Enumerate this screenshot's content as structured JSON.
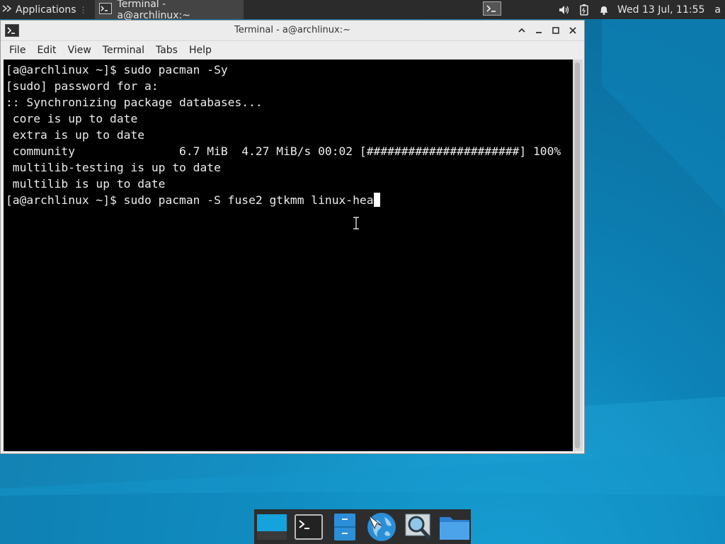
{
  "top_panel": {
    "applications_label": "Applications",
    "task_label": "Terminal - a@archlinux:~",
    "clock": "Wed 13 Jul, 11:55",
    "user_initial": "a",
    "icons": [
      "menu-icon",
      "terminal-icon",
      "workspace-terminal-icon",
      "volume-icon",
      "battery-icon",
      "notification-bell-icon"
    ]
  },
  "window": {
    "title": "Terminal - a@archlinux:~",
    "menu": [
      "File",
      "Edit",
      "View",
      "Terminal",
      "Tabs",
      "Help"
    ],
    "controls": [
      "maximize-up-icon",
      "minimize-icon",
      "restore-icon",
      "close-icon"
    ]
  },
  "terminal": {
    "lines": [
      "[a@archlinux ~]$ sudo pacman -Sy",
      "[sudo] password for a:",
      ":: Synchronizing package databases...",
      " core is up to date",
      " extra is up to date",
      " community               6.7 MiB  4.27 MiB/s 00:02 [######################] 100%",
      " multilib-testing is up to date",
      " multilib is up to date"
    ],
    "prompt_line": "[a@archlinux ~]$ sudo pacman -S fuse2 gtkmm linux-hea"
  },
  "dock": {
    "items": [
      "show-desktop-icon",
      "terminal-icon",
      "file-manager-icon",
      "web-browser-icon",
      "search-icon",
      "folder-icon"
    ]
  },
  "colors": {
    "terminal_bg": "#000000",
    "terminal_fg": "#ececec",
    "panel_bg": "#2b2b2b",
    "desktop": "#0b76a8"
  }
}
